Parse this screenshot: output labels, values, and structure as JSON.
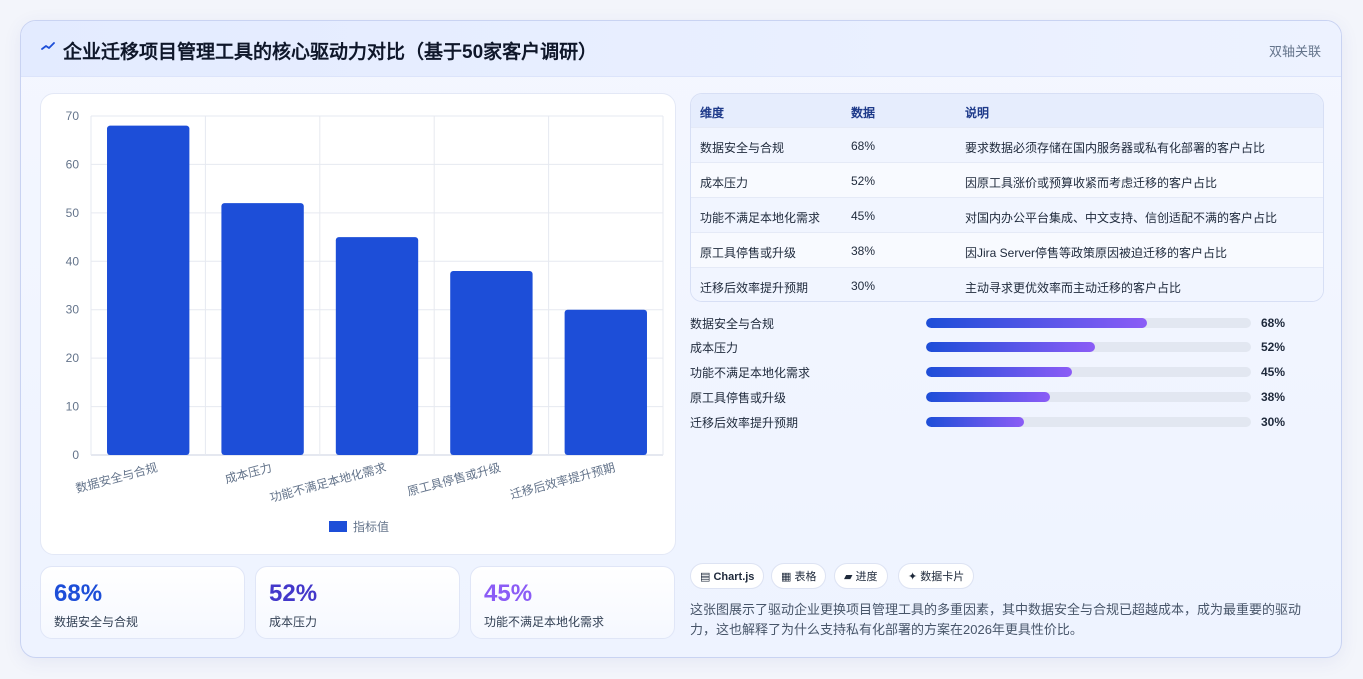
{
  "header": {
    "icon": "trend-icon",
    "title": "企业迁移项目管理工具的核心驱动力对比（基于50家客户调研）",
    "tag": "双轴关联"
  },
  "chart_data": {
    "type": "bar",
    "categories": [
      "数据安全与合规",
      "成本压力",
      "功能不满足本地化需求",
      "原工具停售或升级",
      "迁移后效率提升预期"
    ],
    "series": [
      {
        "name": "指标值",
        "values": [
          68,
          52,
          45,
          38,
          30
        ],
        "color": "#1d4ed8"
      }
    ],
    "ylim": [
      0,
      70
    ],
    "yticks": [
      0,
      10,
      20,
      30,
      40,
      50,
      60,
      70
    ],
    "grid": true,
    "legend_position": "bottom"
  },
  "stats": [
    {
      "value": "68%",
      "label": "数据安全与合规",
      "color": "#1d4ed8"
    },
    {
      "value": "52%",
      "label": "成本压力",
      "color": "#4338ca"
    },
    {
      "value": "45%",
      "label": "功能不满足本地化需求",
      "color": "#8b5cf6"
    }
  ],
  "table": {
    "headers": [
      "维度",
      "数据",
      "说明"
    ],
    "rows": [
      [
        "数据安全与合规",
        "68%",
        "要求数据必须存储在国内服务器或私有化部署的客户占比"
      ],
      [
        "成本压力",
        "52%",
        "因原工具涨价或预算收紧而考虑迁移的客户占比"
      ],
      [
        "功能不满足本地化需求",
        "45%",
        "对国内办公平台集成、中文支持、信创适配不满的客户占比"
      ],
      [
        "原工具停售或升级",
        "38%",
        "因Jira Server停售等政策原因被迫迁移的客户占比"
      ],
      [
        "迁移后效率提升预期",
        "30%",
        "主动寻求更优效率而主动迁移的客户占比"
      ]
    ]
  },
  "progress": [
    {
      "label": "数据安全与合规",
      "value": 68,
      "text": "68%"
    },
    {
      "label": "成本压力",
      "value": 52,
      "text": "52%"
    },
    {
      "label": "功能不满足本地化需求",
      "value": 45,
      "text": "45%"
    },
    {
      "label": "原工具停售或升级",
      "value": 38,
      "text": "38%"
    },
    {
      "label": "迁移后效率提升预期",
      "value": 30,
      "text": "30%"
    }
  ],
  "chips": [
    {
      "icon": "chart-icon",
      "glyph": "▤",
      "label": "Chart.js"
    },
    {
      "icon": "table-icon",
      "glyph": "▦",
      "label": "表格"
    },
    {
      "icon": "progress-icon",
      "glyph": "▰",
      "label": "进度"
    },
    {
      "icon": "sparkle-icon",
      "glyph": "✦",
      "label": "数据卡片"
    }
  ],
  "description": "这张图展示了驱动企业更换项目管理工具的多重因素，其中数据安全与合规已超越成本，成为最重要的驱动力，这也解释了为什么支持私有化部署的方案在2026年更具性价比。"
}
